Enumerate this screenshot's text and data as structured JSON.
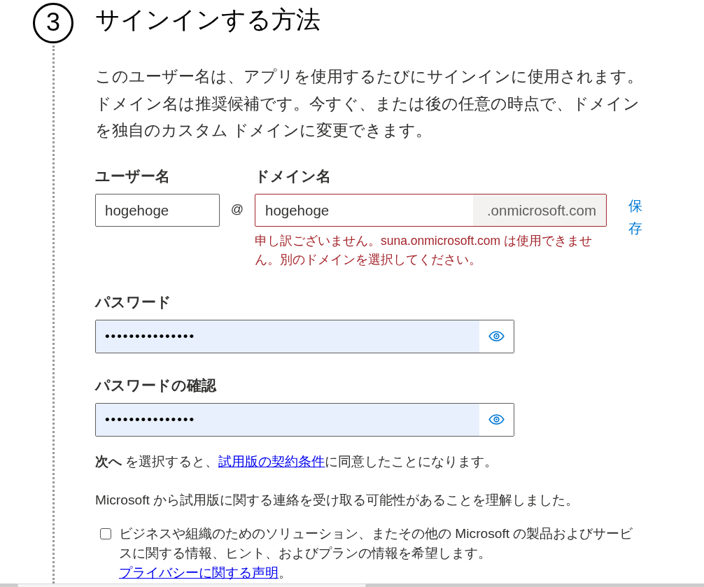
{
  "step": {
    "number": "3",
    "title": "サインインする方法"
  },
  "description": "このユーザー名は、アプリを使用するたびにサインインに使用されます。ドメイン名は推奨候補です。今すぐ、または後の任意の時点で、ドメインを独自のカスタム ドメインに変更できます。",
  "username": {
    "label": "ユーザー名",
    "value": "hogehoge"
  },
  "at_sign": "@",
  "domain": {
    "label": "ドメイン名",
    "value": "hogehoge",
    "suffix": ".onmicrosoft.com",
    "invalid": true,
    "error": "申し訳ございません。suna.onmicrosoft.com は使用できません。別のドメインを選択してください。"
  },
  "save_link": "保存",
  "password_fields": [
    {
      "label": "パスワード",
      "value": "•••••••••••••••",
      "autofilled": true
    },
    {
      "label": "パスワードの確認",
      "value": "•••••••••••••••",
      "autofilled": true
    }
  ],
  "terms": {
    "before": "**次へ** を選択すると、",
    "link": "試用版の契約条件",
    "after": "に同意したことになります。"
  },
  "notice": "Microsoft から試用版に関する連絡を受け取る可能性があることを理解しました。",
  "marketing_opt_in": {
    "checked": false,
    "text": "ビジネスや組織のためのソリューション、またその他の Microsoft の製品およびサービスに関する情報、ヒント、およびプランの情報を希望します。",
    "link": "プライバシーに関する声明",
    "after": "。"
  }
}
